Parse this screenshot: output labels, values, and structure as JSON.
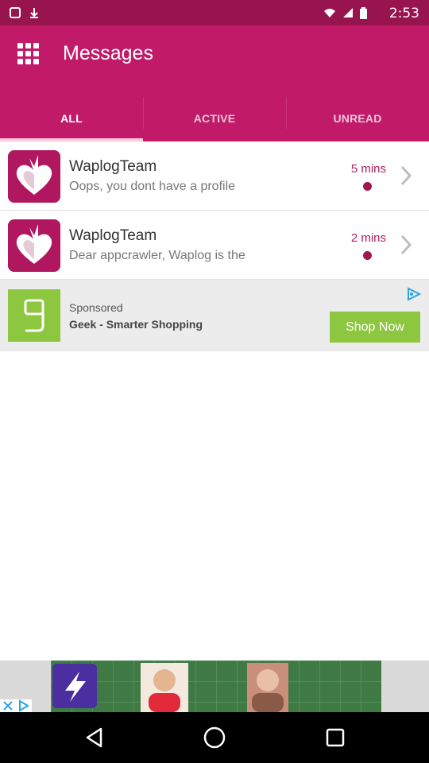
{
  "status_bar": {
    "time": "2:53"
  },
  "app_bar": {
    "title": "Messages",
    "menu_icon": "apps-grid-icon"
  },
  "tabs": [
    {
      "label": "ALL",
      "active": true
    },
    {
      "label": "ACTIVE",
      "active": false
    },
    {
      "label": "UNREAD",
      "active": false
    }
  ],
  "messages": [
    {
      "sender": "WaplogTeam",
      "preview": "Oops, you dont have a profile",
      "time": "5 mins",
      "unread": true
    },
    {
      "sender": "WaplogTeam",
      "preview": "Dear appcrawler, Waplog is the",
      "time": "2 mins",
      "unread": true
    }
  ],
  "sponsored": {
    "label": "Sponsored",
    "name": "Geek - Smarter Shopping",
    "button": "Shop Now"
  },
  "colors": {
    "primary": "#c01a69",
    "status_bar": "#98144e",
    "accent_green": "#8dc63f",
    "unread_dot": "#a0174f"
  },
  "nav": {
    "back": "back-triangle-icon",
    "home": "home-circle-icon",
    "recents": "recents-square-icon"
  }
}
